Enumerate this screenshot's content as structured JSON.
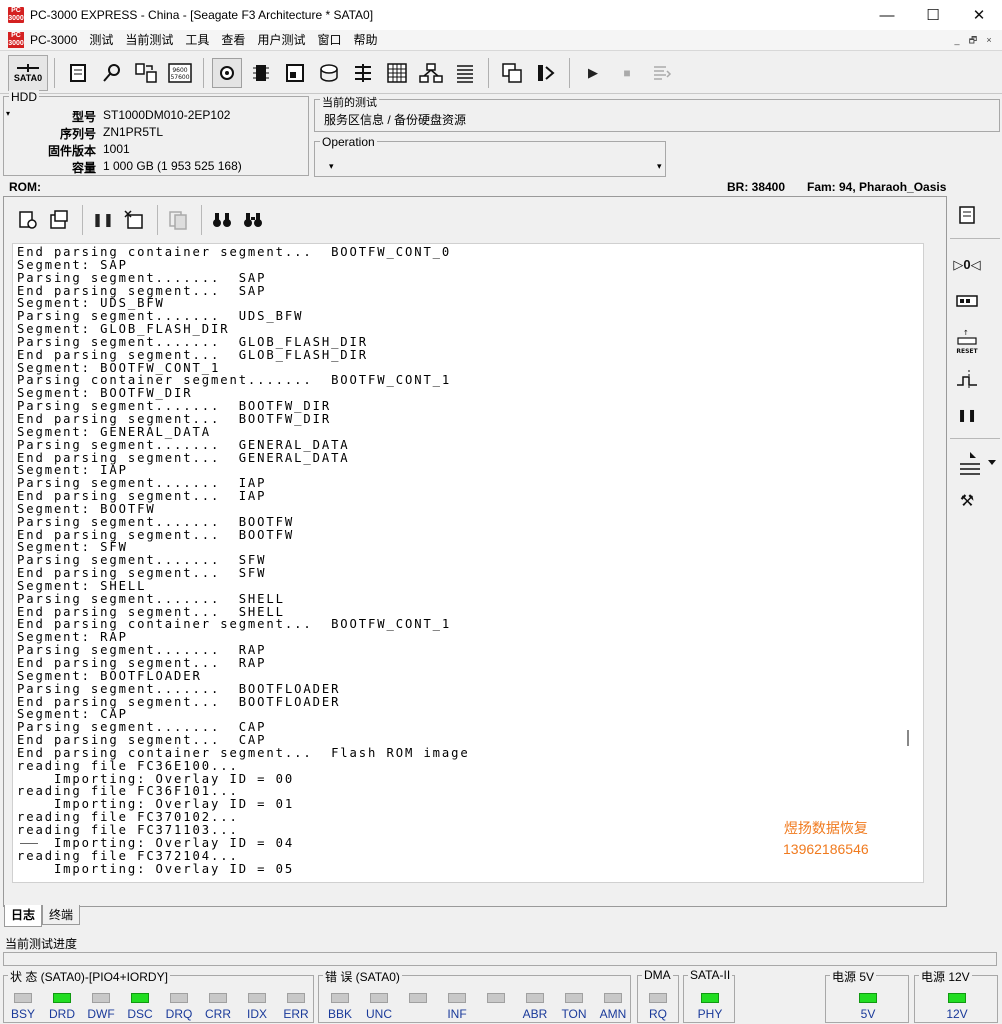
{
  "window": {
    "title": "PC-3000 EXPRESS - China - [Seagate F3 Architecture * SATA0]",
    "logo_text": "PC\n3000",
    "controls": [
      "—",
      "☐",
      "✕"
    ]
  },
  "menu": {
    "items": [
      "PC-3000",
      "测试",
      "当前测试",
      "工具",
      "查看",
      "用户测试",
      "窗口",
      "帮助"
    ],
    "mdi_controls": [
      "_",
      "🗗",
      "×"
    ]
  },
  "toolbar": {
    "sata_label": "SATA0"
  },
  "hdd": {
    "legend": "HDD",
    "fields": [
      {
        "key": "型号",
        "value": "ST1000DM010-2EP102"
      },
      {
        "key": "序列号",
        "value": "ZN1PR5TL"
      },
      {
        "key": "固件版本",
        "value": "1001"
      },
      {
        "key": "容量",
        "value": "1 000 GB (1 953 525 168)"
      }
    ]
  },
  "current_test": {
    "legend": "当前的测试",
    "value": "服务区信息 / 备份硬盘资源"
  },
  "operation": {
    "legend": "Operation"
  },
  "rom_line": {
    "rom": "ROM:",
    "br": "BR: 38400",
    "fam": "Fam: 94, Pharaoh_Oasis"
  },
  "log": {
    "lines": [
      "End parsing container segment...  BOOTFW_CONT_0",
      "Segment: SAP",
      "Parsing segment.......  SAP",
      "End parsing segment...  SAP",
      "Segment: UDS_BFW",
      "Parsing segment.......  UDS_BFW",
      "Segment: GLOB_FLASH_DIR",
      "Parsing segment.......  GLOB_FLASH_DIR",
      "End parsing segment...  GLOB_FLASH_DIR",
      "Segment: BOOTFW_CONT_1",
      "Parsing container segment.......  BOOTFW_CONT_1",
      "Segment: BOOTFW_DIR",
      "Parsing segment.......  BOOTFW_DIR",
      "End parsing segment...  BOOTFW_DIR",
      "Segment: GENERAL_DATA",
      "Parsing segment.......  GENERAL_DATA",
      "End parsing segment...  GENERAL_DATA",
      "Segment: IAP",
      "Parsing segment.......  IAP",
      "End parsing segment...  IAP",
      "Segment: BOOTFW",
      "Parsing segment.......  BOOTFW",
      "End parsing segment...  BOOTFW",
      "Segment: SFW",
      "Parsing segment.......  SFW",
      "End parsing segment...  SFW",
      "Segment: SHELL",
      "Parsing segment.......  SHELL",
      "End parsing segment...  SHELL",
      "End parsing container segment...  BOOTFW_CONT_1",
      "Segment: RAP",
      "Parsing segment.......  RAP",
      "End parsing segment...  RAP",
      "Segment: BOOTFLOADER",
      "Parsing segment.......  BOOTFLOADER",
      "End parsing segment...  BOOTFLOADER",
      "Segment: CAP",
      "Parsing segment.......  CAP",
      "End parsing segment...  CAP",
      "End parsing container segment...  Flash ROM image",
      "reading file FC36E100...",
      "    Importing: Overlay ID = 00",
      "reading file FC36F101...",
      "    Importing: Overlay ID = 01",
      "reading file FC370102...",
      "reading file FC371103...",
      "    Importing: Overlay ID = 04",
      "reading file FC372104...",
      "    Importing: Overlay ID = 05"
    ],
    "watermark_line1": "煜扬数据恢复",
    "watermark_line2": "13962186546"
  },
  "tabs": [
    {
      "label": "日志",
      "active": true
    },
    {
      "label": "终端",
      "active": false
    }
  ],
  "progress": {
    "label": "当前测试进度"
  },
  "status": {
    "group1": {
      "legend": "状 态 (SATA0)-[PIO4+IORDY]",
      "indicators": [
        {
          "name": "BSY",
          "on": false
        },
        {
          "name": "DRD",
          "on": true
        },
        {
          "name": "DWF",
          "on": false
        },
        {
          "name": "DSC",
          "on": true
        },
        {
          "name": "DRQ",
          "on": false
        },
        {
          "name": "CRR",
          "on": false
        },
        {
          "name": "IDX",
          "on": false
        },
        {
          "name": "ERR",
          "on": false
        }
      ]
    },
    "group2": {
      "legend": "错 误 (SATA0)",
      "indicators": [
        {
          "name": "BBK",
          "on": false
        },
        {
          "name": "UNC",
          "on": false
        },
        {
          "name": "",
          "on": false
        },
        {
          "name": "INF",
          "on": false
        },
        {
          "name": "",
          "on": false
        },
        {
          "name": "ABR",
          "on": false
        },
        {
          "name": "TON",
          "on": false
        },
        {
          "name": "AMN",
          "on": false
        }
      ]
    },
    "dma": {
      "legend": "DMA",
      "name": "RQ",
      "on": false
    },
    "sata": {
      "legend": "SATA-II",
      "name": "PHY",
      "on": true
    },
    "power5": {
      "legend": "电源 5V",
      "name": "5V",
      "on": true
    },
    "power12": {
      "legend": "电源 12V",
      "name": "12V",
      "on": true
    }
  },
  "colors": {
    "led_on": "#22dd22",
    "led_off": "#c8c8c8",
    "indicator_text": "#1a3a9a",
    "watermark": "#f07a1e",
    "logo": "#d42020"
  }
}
